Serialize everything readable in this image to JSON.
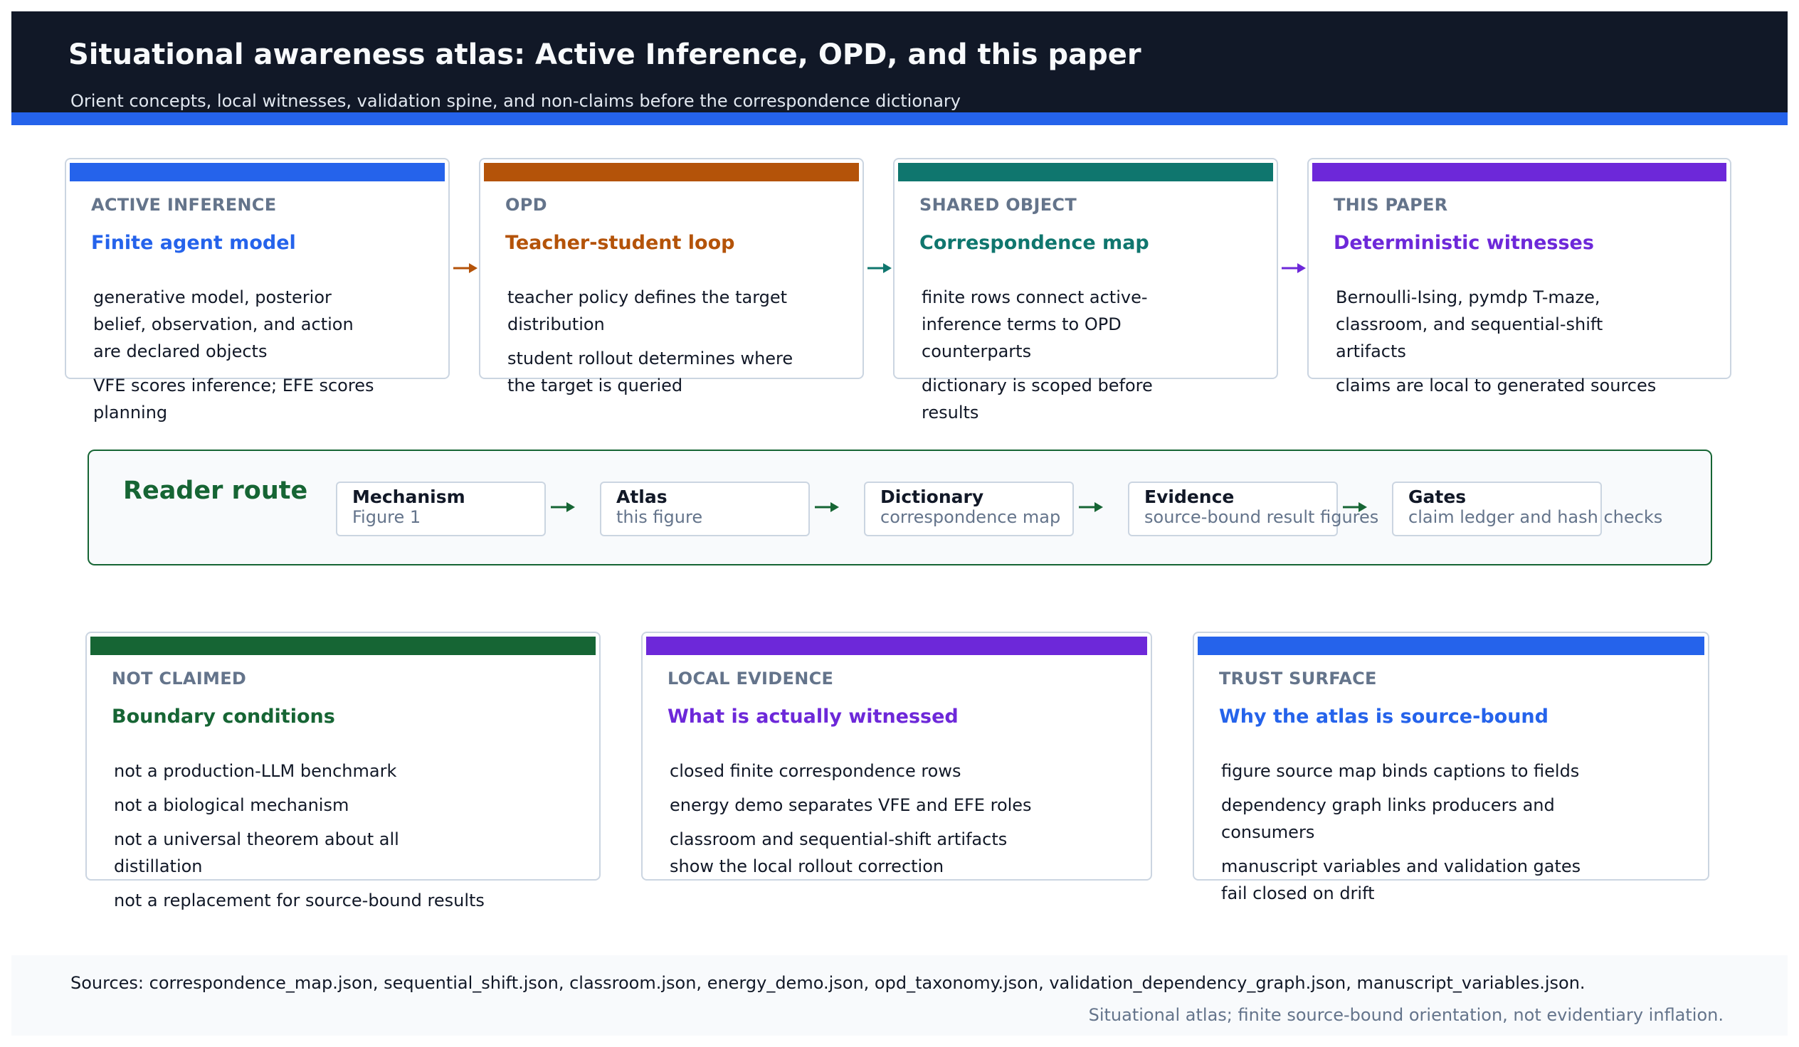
{
  "header": {
    "title": "Situational awareness atlas: Active Inference, OPD, and this paper",
    "subtitle": "Orient concepts, local witnesses, validation spine, and non-claims before the correspondence dictionary"
  },
  "top_cards": [
    {
      "kicker": "ACTIVE INFERENCE",
      "heading": "Finite agent model",
      "accent": "#2563eb",
      "paragraphs": [
        [
          "generative model, posterior",
          "belief, observation, and action",
          "are declared objects"
        ],
        [
          "VFE scores inference; EFE scores",
          "planning"
        ]
      ]
    },
    {
      "kicker": "OPD",
      "heading": "Teacher-student loop",
      "accent": "#b45309",
      "paragraphs": [
        [
          "teacher policy defines the target",
          "distribution"
        ],
        [
          "student rollout determines where",
          "the target is queried"
        ]
      ]
    },
    {
      "kicker": "SHARED OBJECT",
      "heading": "Correspondence map",
      "accent": "#0f766e",
      "paragraphs": [
        [
          "finite rows connect active-",
          "inference terms to OPD",
          "counterparts"
        ],
        [
          "dictionary is scoped before",
          "results"
        ]
      ]
    },
    {
      "kicker": "THIS PAPER",
      "heading": "Deterministic witnesses",
      "accent": "#6d28d9",
      "paragraphs": [
        [
          "Bernoulli-Ising, pymdp T-maze,",
          "classroom, and sequential-shift",
          "artifacts"
        ],
        [
          "claims are local to generated sources"
        ]
      ]
    }
  ],
  "route": {
    "title": "Reader route",
    "accent": "#166534",
    "steps": [
      {
        "title": "Mechanism",
        "subtitle": "Figure 1"
      },
      {
        "title": "Atlas",
        "subtitle": "this figure"
      },
      {
        "title": "Dictionary",
        "subtitle": "correspondence map"
      },
      {
        "title": "Evidence",
        "subtitle": "source-bound result figures"
      },
      {
        "title": "Gates",
        "subtitle": "claim ledger and hash checks"
      }
    ]
  },
  "bottom_cards": [
    {
      "kicker": "NOT CLAIMED",
      "heading": "Boundary conditions",
      "accent": "#166534",
      "paragraphs": [
        [
          "not a production-LLM benchmark"
        ],
        [
          "not a biological mechanism"
        ],
        [
          "not a universal theorem about all",
          "distillation"
        ],
        [
          "not a replacement for source-bound results"
        ]
      ]
    },
    {
      "kicker": "LOCAL EVIDENCE",
      "heading": "What is actually witnessed",
      "accent": "#6d28d9",
      "paragraphs": [
        [
          "closed finite correspondence rows"
        ],
        [
          "energy demo separates VFE and EFE roles"
        ],
        [
          "classroom and sequential-shift artifacts",
          "show the local rollout correction"
        ]
      ]
    },
    {
      "kicker": "TRUST SURFACE",
      "heading": "Why the atlas is source-bound",
      "accent": "#2563eb",
      "paragraphs": [
        [
          "figure source map binds captions to fields"
        ],
        [
          "dependency graph links producers and",
          "consumers"
        ],
        [
          "manuscript variables and validation gates",
          "fail closed on drift"
        ]
      ]
    }
  ],
  "footer": {
    "sources": "Sources: correspondence_map.json, sequential_shift.json, classroom.json, energy_demo.json, opd_taxonomy.json, validation_dependency_graph.json, manuscript_variables.json.",
    "note": "Situational atlas; finite source-bound orientation, not evidentiary inflation."
  }
}
